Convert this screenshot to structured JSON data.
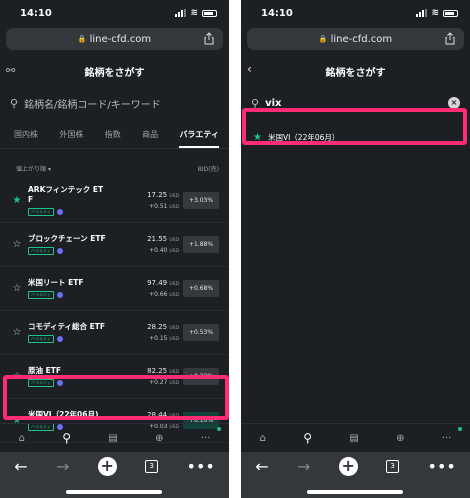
{
  "status": {
    "time": "14:10"
  },
  "browser": {
    "url": "line-cfd.com",
    "tab_count": "3"
  },
  "app": {
    "title": "銘柄をさがす"
  },
  "left": {
    "search_placeholder": "銘柄名/銘柄コード/キーワード",
    "tabs": [
      "国内株",
      "外国株",
      "指数",
      "商品",
      "バラエティ"
    ],
    "active_tab": "バラエティ",
    "sort_label": "値上がり順",
    "bid_header": "BID(売)",
    "unit": "USD",
    "items": [
      {
        "name_line1": "ARKフィンテック ET",
        "name_line2": "F",
        "badge": "バラエティ",
        "bid": "17.25",
        "change": "+0.51",
        "pct": "+3.03%",
        "fav": true
      },
      {
        "name_line1": "ブロックチェーン ETF",
        "name_line2": "",
        "badge": "バラエティ",
        "bid": "21.55",
        "change": "+0.40",
        "pct": "+1.88%",
        "fav": false
      },
      {
        "name_line1": "米国リート ETF",
        "name_line2": "",
        "badge": "バラエティ",
        "bid": "97.49",
        "change": "+0.66",
        "pct": "+0.68%",
        "fav": false
      },
      {
        "name_line1": "コモディティ総合 ETF",
        "name_line2": "",
        "badge": "バラエティ",
        "bid": "28.25",
        "change": "+0.15",
        "pct": "+0.53%",
        "fav": false
      },
      {
        "name_line1": "原油 ETF",
        "name_line2": "",
        "badge": "バラエティ",
        "bid": "82.25",
        "change": "+0.27",
        "pct": "+0.32%",
        "fav": false
      },
      {
        "name_line1": "米国VI（22年06月)",
        "name_line2": "",
        "badge": "バラエティ",
        "bid": "28.44",
        "change": "+0.03",
        "pct": "+0.10%",
        "fav": true
      }
    ]
  },
  "right": {
    "search_value": "vix",
    "result": "米国VI（22年06月）"
  },
  "colors": {
    "accent": "#1ec38a",
    "highlight": "#ff2c74",
    "bg": "#1c1f23"
  }
}
